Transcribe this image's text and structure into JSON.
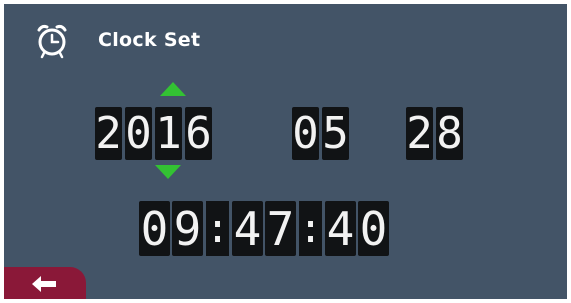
{
  "header": {
    "title": "Clock Set",
    "icon": "alarm-clock-icon"
  },
  "date": {
    "year": [
      "2",
      "0",
      "1",
      "6"
    ],
    "month": [
      "0",
      "5"
    ],
    "day": [
      "2",
      "8"
    ]
  },
  "time": {
    "hours": [
      "0",
      "9"
    ],
    "minutes": [
      "4",
      "7"
    ],
    "seconds": [
      "4",
      "0"
    ],
    "separator": ":"
  },
  "controls": {
    "increment_icon": "arrow-up-icon",
    "decrement_icon": "arrow-down-icon",
    "back_icon": "back-arrow-icon"
  },
  "colors": {
    "background": "#435467",
    "digit_bg": "#111315",
    "arrow": "#33c233",
    "back_button": "#8a1838"
  }
}
